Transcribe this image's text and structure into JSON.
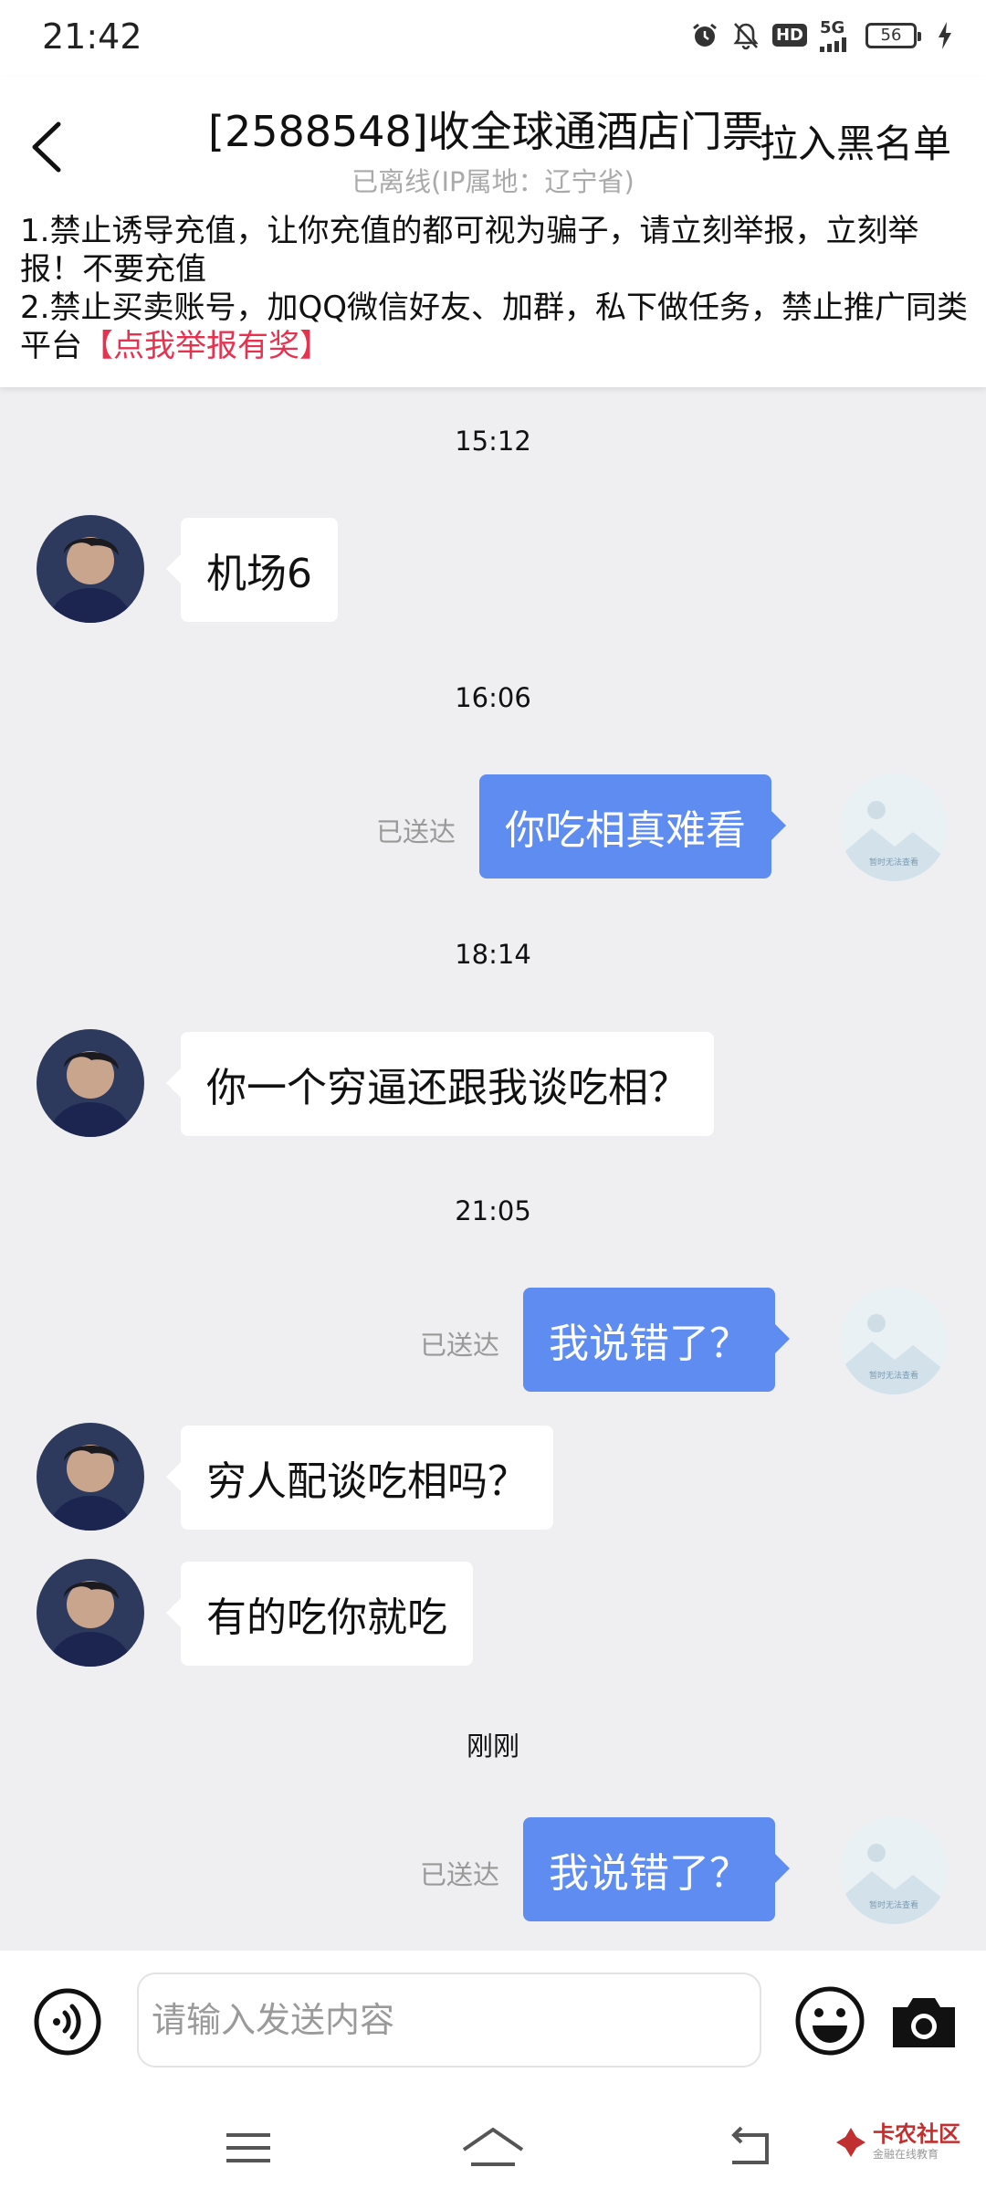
{
  "status_bar": {
    "time": "21:42",
    "network": "5G",
    "battery": "56",
    "hd": "HD",
    "icons": [
      "alarm-icon",
      "mute-bell-icon",
      "hd-icon",
      "signal-icon",
      "battery-icon",
      "charging-icon"
    ]
  },
  "header": {
    "title": "[2588548]收全球通酒店门票",
    "blacklist_label": "拉入黑名单",
    "subtitle": "已离线(IP属地：辽宁省)",
    "notice_line1": "1.禁止诱导充值，让你充值的都可视为骗子，请立刻举报，立刻举报！不要充值",
    "notice_line2": "2.禁止买卖账号，加QQ微信好友、加群，私下做任务，禁止推广同类平台",
    "notice_link": "【点我举报有奖】",
    "accent_color": "#e8314f"
  },
  "chat": {
    "self_avatar_text": "暂时无法查看",
    "messages": [
      {
        "time": "15:12"
      },
      {
        "from": "other",
        "text": "机场6"
      },
      {
        "time": "16:06"
      },
      {
        "from": "self",
        "text": "你吃相真难看",
        "status": "已送达"
      },
      {
        "time": "18:14"
      },
      {
        "from": "other",
        "text": "你一个穷逼还跟我谈吃相？"
      },
      {
        "time": "21:05"
      },
      {
        "from": "self",
        "text": "我说错了？",
        "status": "已送达"
      },
      {
        "from": "other",
        "text": "穷人配谈吃相吗？"
      },
      {
        "from": "other",
        "text": "有的吃你就吃"
      },
      {
        "time": "刚刚"
      },
      {
        "from": "self",
        "text": "我说错了？",
        "status": "已送达"
      }
    ],
    "outgoing_color": "#5f8cf0"
  },
  "input_bar": {
    "placeholder": "请输入发送内容",
    "value": ""
  },
  "watermark": {
    "name": "卡农社区",
    "tagline": "金融在线教育"
  }
}
